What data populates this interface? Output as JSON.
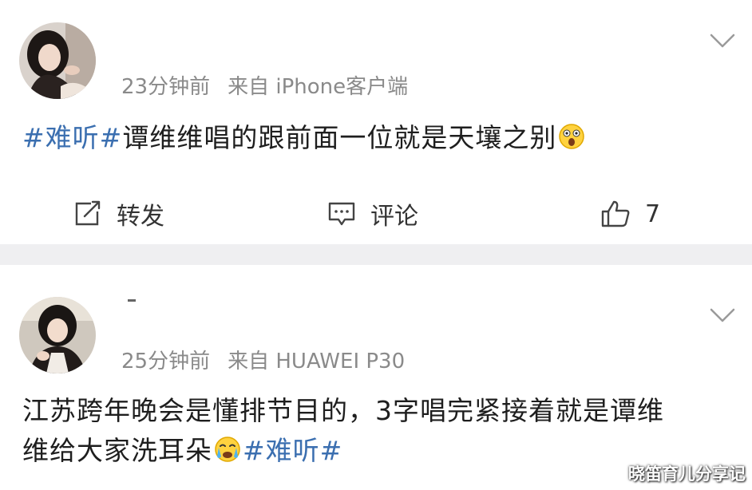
{
  "posts": [
    {
      "time": "23分钟前",
      "source": "来自 iPhone客户端",
      "text_tag": "#难听#",
      "text_body": "谭维维唱的跟前面一位就是天壤之别",
      "emoji": "astonished-emoji",
      "actions": {
        "repost_label": "转发",
        "comment_label": "评论",
        "like_count": "7"
      }
    },
    {
      "time": "25分钟前",
      "source": "来自 HUAWEI P30",
      "text_line1": "江苏跨年晚会是懂排节目的，3字唱完紧接着就是谭维",
      "text_line2_body": "维给大家洗耳朵",
      "text_line2_tag": "#难听#",
      "emoji": "crying-emoji"
    }
  ],
  "watermark": "晓笛育儿分享记",
  "colors": {
    "tag": "#3b6fb0",
    "meta": "#8a8a8a",
    "separator": "#efeff1",
    "text": "#1e1e1e"
  }
}
